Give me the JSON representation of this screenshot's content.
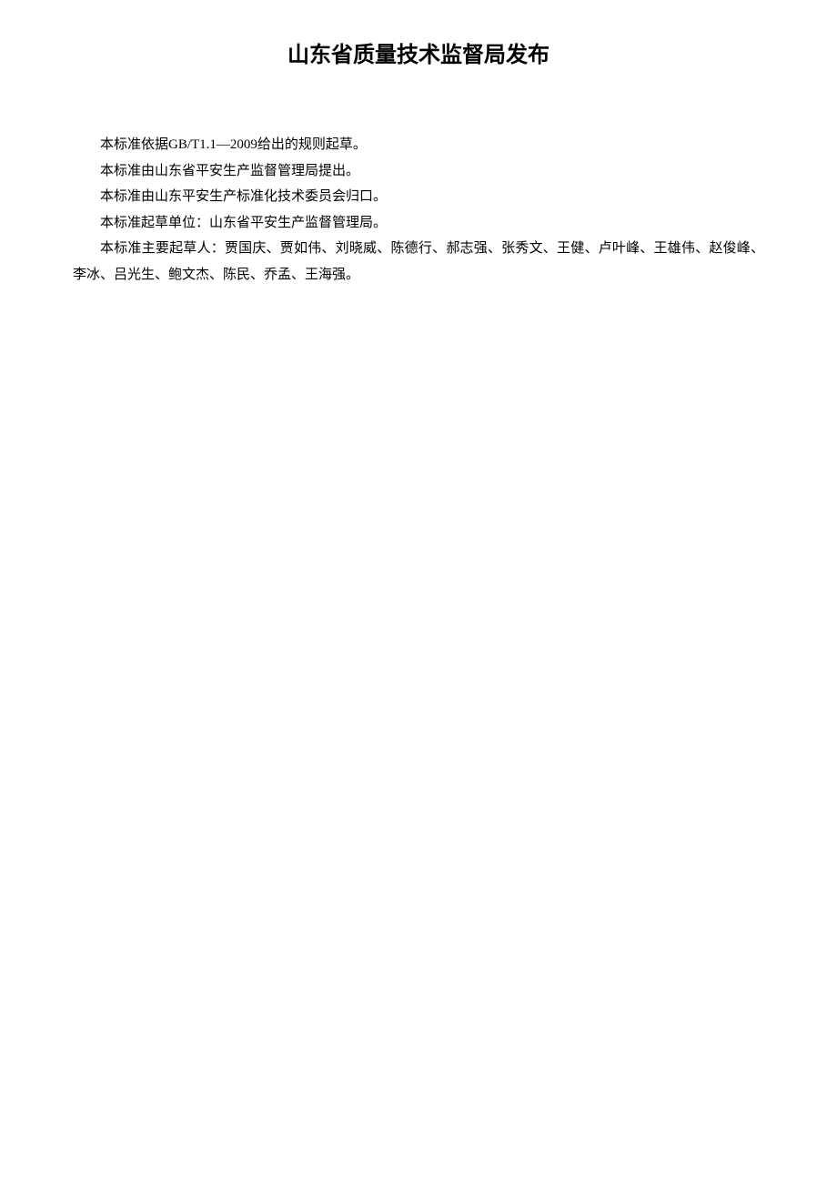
{
  "title": "山东省质量技术监督局发布",
  "paragraphs": [
    "本标准依据GB/T1.1—2009给出的规则起草。",
    "本标准由山东省平安生产监督管理局提出。",
    "本标准由山东平安生产标准化技术委员会归口。",
    "本标准起草单位：山东省平安生产监督管理局。",
    "本标准主要起草人：贾国庆、贾如伟、刘晓威、陈德行、郝志强、张秀文、王健、卢叶峰、王雄伟、赵俊峰、李冰、吕光生、鲍文杰、陈民、乔孟、王海强。"
  ]
}
